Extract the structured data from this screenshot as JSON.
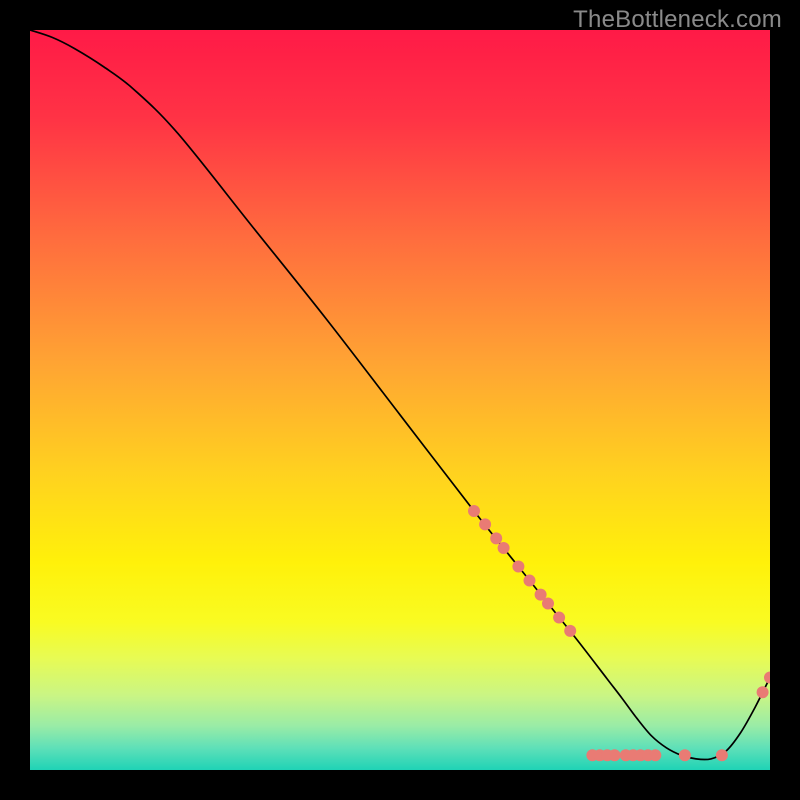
{
  "watermark": "TheBottleneck.com",
  "chart_data": {
    "type": "line",
    "title": "",
    "xlabel": "",
    "ylabel": "",
    "xlim": [
      0,
      100
    ],
    "ylim": [
      0,
      100
    ],
    "grid": false,
    "legend": false,
    "background_gradient": {
      "type": "vertical",
      "stops": [
        {
          "offset": 0.0,
          "color": "#ff1a47"
        },
        {
          "offset": 0.12,
          "color": "#ff3345"
        },
        {
          "offset": 0.28,
          "color": "#ff6c3e"
        },
        {
          "offset": 0.45,
          "color": "#ffa433"
        },
        {
          "offset": 0.6,
          "color": "#ffd21f"
        },
        {
          "offset": 0.72,
          "color": "#fff10a"
        },
        {
          "offset": 0.8,
          "color": "#f9fb22"
        },
        {
          "offset": 0.85,
          "color": "#e7fb55"
        },
        {
          "offset": 0.9,
          "color": "#c9f585"
        },
        {
          "offset": 0.94,
          "color": "#9aeca6"
        },
        {
          "offset": 0.97,
          "color": "#5fe0b8"
        },
        {
          "offset": 1.0,
          "color": "#1fd3b6"
        }
      ]
    },
    "series": [
      {
        "name": "curve",
        "color": "#000000",
        "width": 1.7,
        "x": [
          0,
          3,
          6,
          10,
          14,
          20,
          30,
          40,
          50,
          60,
          66,
          70,
          74,
          78,
          80,
          82,
          84,
          86,
          88,
          90,
          92,
          94,
          96,
          98,
          100
        ],
        "y": [
          100,
          99,
          97.5,
          95,
          92,
          86,
          73.5,
          61,
          48,
          35,
          27.5,
          22.5,
          17.5,
          12.3,
          9.7,
          7.0,
          4.6,
          3.0,
          2.0,
          1.5,
          1.5,
          2.5,
          5.0,
          8.5,
          12.5
        ]
      }
    ],
    "markers": {
      "color": "#e97b74",
      "radius_px": 6,
      "points": [
        {
          "x": 60.0,
          "y": 35.0
        },
        {
          "x": 61.5,
          "y": 33.2
        },
        {
          "x": 63.0,
          "y": 31.3
        },
        {
          "x": 64.0,
          "y": 30.0
        },
        {
          "x": 66.0,
          "y": 27.5
        },
        {
          "x": 67.5,
          "y": 25.6
        },
        {
          "x": 69.0,
          "y": 23.7
        },
        {
          "x": 70.0,
          "y": 22.5
        },
        {
          "x": 71.5,
          "y": 20.6
        },
        {
          "x": 73.0,
          "y": 18.8
        },
        {
          "x": 76.0,
          "y": 2.0
        },
        {
          "x": 77.0,
          "y": 2.0
        },
        {
          "x": 78.0,
          "y": 2.0
        },
        {
          "x": 79.0,
          "y": 2.0
        },
        {
          "x": 80.5,
          "y": 2.0
        },
        {
          "x": 81.5,
          "y": 2.0
        },
        {
          "x": 82.5,
          "y": 2.0
        },
        {
          "x": 83.5,
          "y": 2.0
        },
        {
          "x": 84.5,
          "y": 2.0
        },
        {
          "x": 88.5,
          "y": 2.0
        },
        {
          "x": 93.5,
          "y": 2.0
        },
        {
          "x": 99.0,
          "y": 10.5
        },
        {
          "x": 100.0,
          "y": 12.5
        }
      ]
    }
  }
}
